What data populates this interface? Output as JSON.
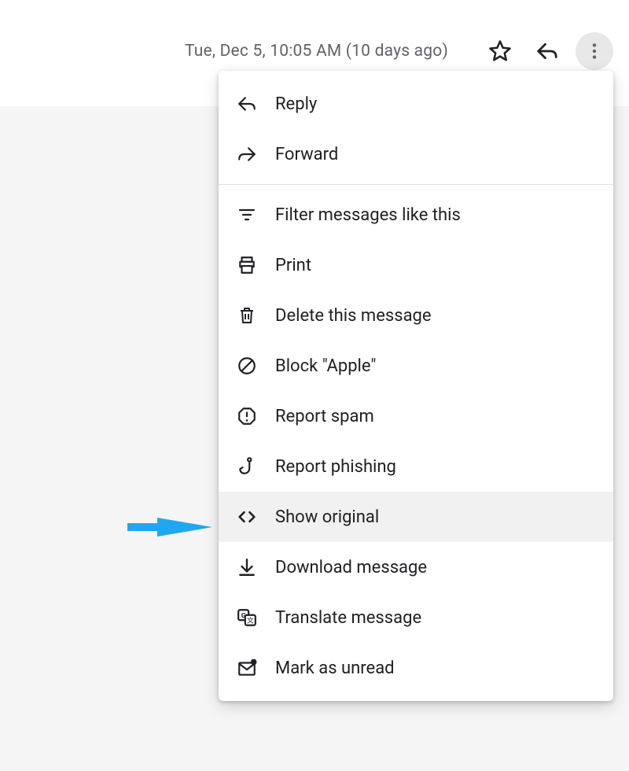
{
  "header": {
    "timestamp": "Tue, Dec 5, 10:05 AM (10 days ago)"
  },
  "menu": {
    "reply": "Reply",
    "forward": "Forward",
    "filter": "Filter messages like this",
    "print": "Print",
    "delete": "Delete this message",
    "block": "Block \"Apple\"",
    "spam": "Report spam",
    "phishing": "Report phishing",
    "show_original": "Show original",
    "download": "Download message",
    "translate": "Translate message",
    "unread": "Mark as unread"
  }
}
